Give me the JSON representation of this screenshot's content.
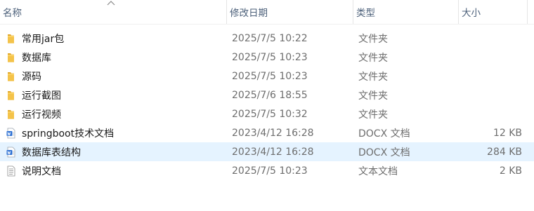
{
  "header": {
    "name_label": "名称",
    "date_label": "修改日期",
    "type_label": "类型",
    "size_label": "大小"
  },
  "files": [
    {
      "name": "常用jar包",
      "date": "2025/7/5 10:22",
      "type": "文件夹",
      "size": "",
      "icon": "folder-icon"
    },
    {
      "name": "数据库",
      "date": "2025/7/5 10:23",
      "type": "文件夹",
      "size": "",
      "icon": "folder-icon"
    },
    {
      "name": "源码",
      "date": "2025/7/5 10:23",
      "type": "文件夹",
      "size": "",
      "icon": "folder-icon"
    },
    {
      "name": "运行截图",
      "date": "2025/7/6 18:55",
      "type": "文件夹",
      "size": "",
      "icon": "folder-icon"
    },
    {
      "name": "运行视频",
      "date": "2025/7/5 10:32",
      "type": "文件夹",
      "size": "",
      "icon": "folder-icon"
    },
    {
      "name": "springboot技术文档",
      "date": "2023/4/12 16:28",
      "type": "DOCX 文档",
      "size": "12 KB",
      "icon": "word-document-icon"
    },
    {
      "name": "数据库表结构",
      "date": "2023/4/12 16:28",
      "type": "DOCX 文档",
      "size": "284 KB",
      "icon": "word-document-icon",
      "selected": true
    },
    {
      "name": "说明文档",
      "date": "2025/7/5 10:23",
      "type": "文本文档",
      "size": "2 KB",
      "icon": "text-document-icon"
    }
  ],
  "colors": {
    "folder": "#f4c34a",
    "word": "#2b6fd3",
    "selection": "#e5f3ff",
    "header_text": "#4c607a"
  }
}
